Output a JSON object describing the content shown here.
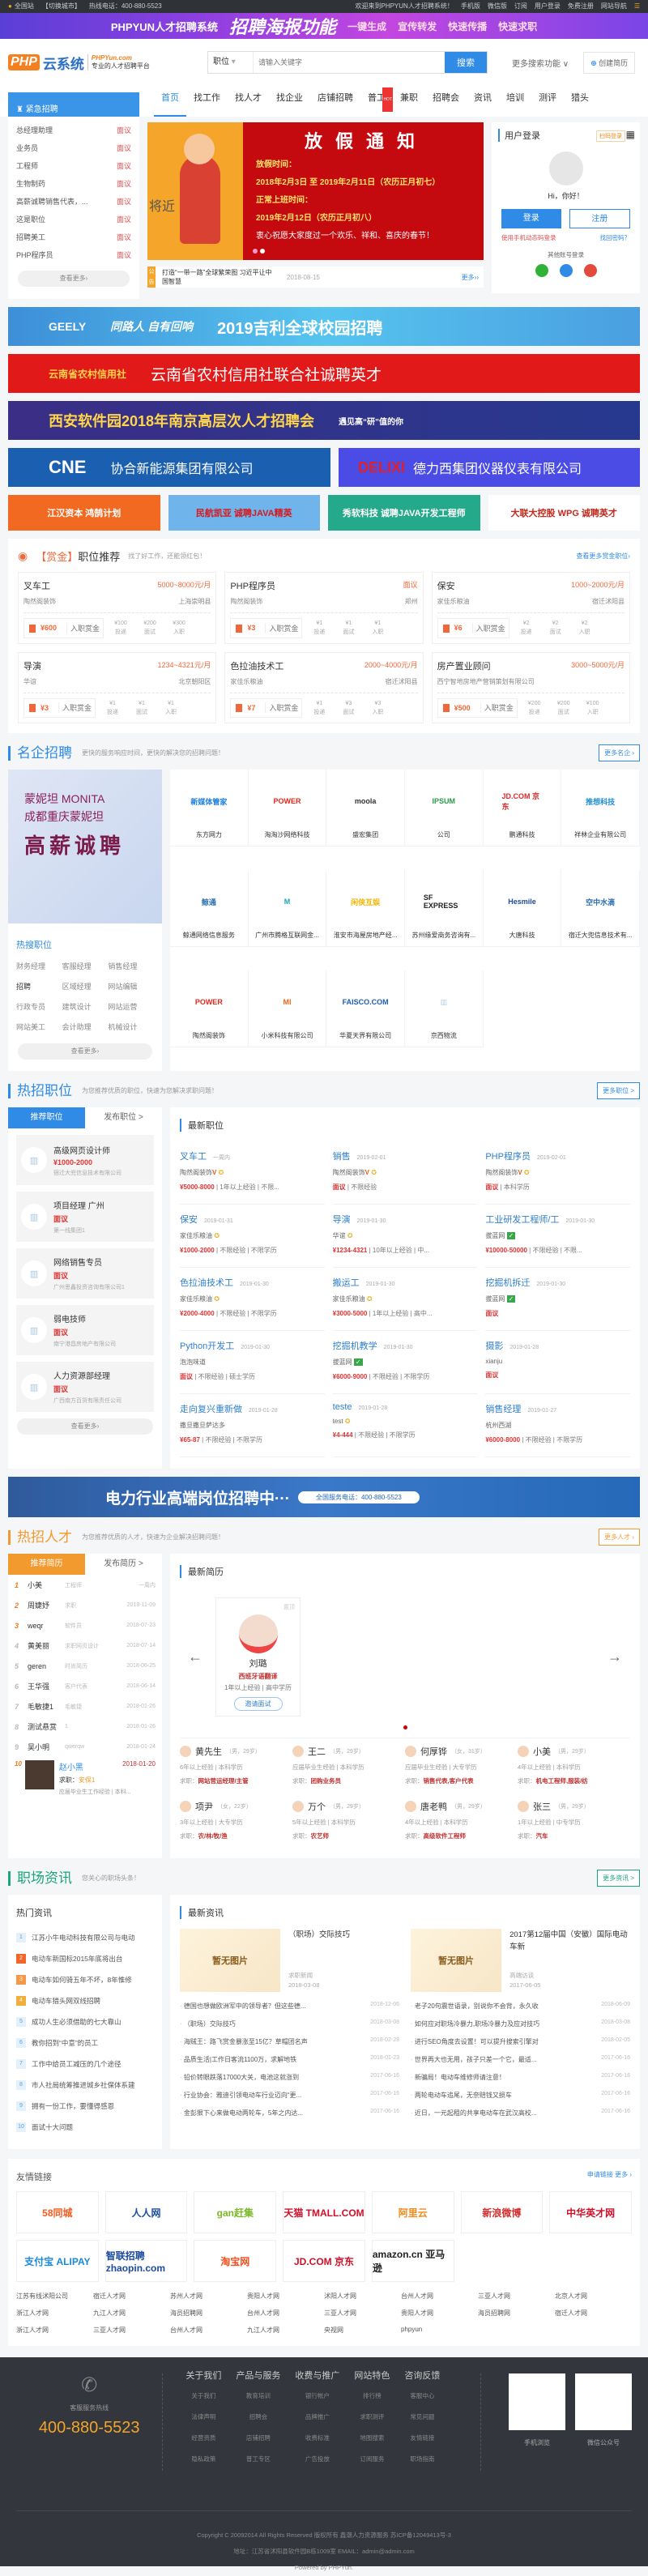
{
  "topbar": {
    "city": "全国站",
    "switch": "【切换城市】",
    "hotline": "热线电话：400-880-5523",
    "welcome": "欢迎来到PHPYUN人才招聘系统！",
    "mobile": "手机版",
    "wechat": "微信版",
    "subscribe": "订阅",
    "login": "用户登录",
    "register": "免费注册",
    "sitenav": "网站导航"
  },
  "promo": {
    "brand": "PHPYUN人才招聘系统",
    "headline": "招聘海报功能",
    "features": [
      "一键生成",
      "宣传转发",
      "快速传播",
      "快速求职"
    ]
  },
  "header": {
    "logo_php": "PHP",
    "logo_yun": "云系统",
    "logo_domain": "PHPYun.com",
    "logo_slogan": "专业的人才招聘平台",
    "search_type": "职位",
    "search_placeholder": "请输入关键字",
    "search_button": "搜索",
    "more_search": "更多搜索功能 ∨",
    "create_resume": "创建简历"
  },
  "nav": {
    "urgent_title": "紧急招聘",
    "items": [
      "首页",
      "找工作",
      "找人才",
      "找企业",
      "店铺招聘",
      "普工",
      "兼职",
      "招聘会",
      "资讯",
      "培训",
      "测评",
      "猎头"
    ],
    "hot_badge": "HOT"
  },
  "urgent": {
    "items": [
      {
        "name": "总经理助理",
        "salary": "面议"
      },
      {
        "name": "业务员",
        "salary": "面议"
      },
      {
        "name": "工程师",
        "salary": "面议"
      },
      {
        "name": "生物制药",
        "salary": "面议"
      },
      {
        "name": "高薪诚聘销售代表，...",
        "salary": "面议"
      },
      {
        "name": "这是职位",
        "salary": "面议"
      },
      {
        "name": "招聘美工",
        "salary": "面议"
      },
      {
        "name": "PHP程序员",
        "salary": "面议"
      }
    ],
    "more": "查看更多›"
  },
  "slider": {
    "title": "放假通知",
    "line1": "放假时间：",
    "line2": "2018年2月3日 至 2019年2月11日（农历正月初七）",
    "line3": "正常上班时间：",
    "line4": "2019年2月12日（农历正月初八）",
    "line5": "衷心祝愿大家度过一个欢乐、祥和、喜庆的春节！",
    "left_text": "将近"
  },
  "notice": {
    "tag": "公告",
    "text": "打造“一带一路”全球繁荣图 习近平让中国智慧",
    "date": "2018-08-15",
    "more": "更多››"
  },
  "login": {
    "title": "用户登录",
    "scan": "扫码登录",
    "hi": "Hi，你好！",
    "login": "登录",
    "register": "注册",
    "sms": "使用手机动态码登录",
    "forgot": "找回密码？",
    "other": "其他账号登录",
    "colors": {
      "wechat": "#2fb236",
      "qq": "#2f8be6",
      "weibo": "#e24b3b"
    }
  },
  "banners": {
    "geely": "2019吉利全球校园招聘",
    "geely_brand": "GEELY",
    "geely_slogan": "同路人 自有回响",
    "yn": "云南省农村信用社联合社诚聘英才",
    "yn_brand": "云南省农村信用社",
    "xa": "西安软件园2018年南京高层次人才招聘会",
    "xa_tag": "遇见高“研”值的你",
    "cne": "协合新能源集团有限公司",
    "cne_brand": "CNE",
    "delixi": "德力西集团仪器仪表有限公司",
    "delixi_brand": "DELIXI",
    "small": [
      "江汉资本 鸿鹄计划",
      "民航凯亚 诚聘JAVA精英",
      "秀软科技 诚聘JAVA开发工程师",
      "大联大控股 WPG 诚聘英才"
    ]
  },
  "reward": {
    "tag": "【赏金】",
    "title": "职位推荐",
    "sub": "找了好工作，还能领红包！",
    "more": "查看更多赏金职位›",
    "label": "入职赏金",
    "stages": [
      "投递",
      "面试",
      "入职"
    ],
    "cards": [
      {
        "name": "叉车工",
        "salary": "5000~8000元/月",
        "company": "陶然阁装饰",
        "loc": "上海崇明县",
        "money": "¥600",
        "s": [
          "¥100",
          "¥200",
          "¥300"
        ]
      },
      {
        "name": "PHP程序员",
        "salary": "面议",
        "company": "陶然阁装饰",
        "loc": "郑州",
        "money": "¥3",
        "s": [
          "¥1",
          "¥1",
          "¥1"
        ]
      },
      {
        "name": "保安",
        "salary": "1000~2000元/月",
        "company": "家佳乐粮油",
        "loc": "宿迁沭阳县",
        "money": "¥6",
        "s": [
          "¥2",
          "¥2",
          "¥2"
        ]
      },
      {
        "name": "导演",
        "salary": "1234~4321元/月",
        "company": "华谊",
        "loc": "北京朝阳区",
        "money": "¥3",
        "s": [
          "¥1",
          "¥1",
          "¥1"
        ]
      },
      {
        "name": "色拉油技术工",
        "salary": "2000~4000元/月",
        "company": "家佳乐粮油",
        "loc": "宿迁沭阳县",
        "money": "¥7",
        "s": [
          "¥1",
          "¥3",
          "¥3"
        ]
      },
      {
        "name": "房产置业顾问",
        "salary": "3000~5000元/月",
        "company": "西宁智地房地产营销策划有限公司",
        "loc": "",
        "money": "¥500",
        "s": [
          "¥200",
          "¥200",
          "¥100"
        ]
      }
    ]
  },
  "famous": {
    "title": "名企招聘",
    "sub": "更快的服务响应时间，更快的解决您的招聘问题！",
    "more": "更多名企 ›",
    "ad_brand": "蒙妮坦 MONITA",
    "ad_line": "成都重庆蒙妮坦",
    "ad_big": "高薪诚聘",
    "hot_title": "热搜职位",
    "hot": [
      "财务经理",
      "客服经理",
      "销售经理",
      "招聘",
      "区域经理",
      "网站编辑",
      "行政专员",
      "建筑设计",
      "网站运营",
      "网站美工",
      "会计助理",
      "机械设计"
    ],
    "more_btn": "查看更多›",
    "companies": [
      {
        "name": "东方网力",
        "logo": "新媒体管家",
        "color": "#1b7fe0"
      },
      {
        "name": "淘淘沙网络科技",
        "logo": "POWER",
        "color": "#e0281e"
      },
      {
        "name": "盛宏集团",
        "logo": "moola",
        "color": "#333333"
      },
      {
        "name": "公司",
        "logo": "IPSUM",
        "color": "#2a9a4a"
      },
      {
        "name": "鹏通科技",
        "logo": "JD.COM 京东",
        "color": "#d92b2b"
      },
      {
        "name": "祥林企业有限公司",
        "logo": "推想科技",
        "color": "#1f8fd0"
      },
      {
        "name": "鲸通网络信息服务",
        "logo": "鲸通",
        "color": "#2a6fb0"
      },
      {
        "name": "广州市腾格互联网金...",
        "logo": "M",
        "color": "#1aa5b8"
      },
      {
        "name": "淮安市海屋房地产经...",
        "logo": "闲侠互娱",
        "color": "#f5b400"
      },
      {
        "name": "苏州缘爱商务咨询有...",
        "logo": "SF EXPRESS",
        "color": "#222222"
      },
      {
        "name": "大唐科技",
        "logo": "Hesmile",
        "color": "#1c4aa0"
      },
      {
        "name": "宿迁大兜信息技术有...",
        "logo": "空中水滴",
        "color": "#2a6fb0"
      },
      {
        "name": "陶然阁装饰",
        "logo": "POWER",
        "color": "#e0281e"
      },
      {
        "name": "小米科技有限公司",
        "logo": "MI",
        "color": "#e86a1a"
      },
      {
        "name": "华夏天界有限公司",
        "logo": "FAISCO.COM",
        "color": "#1f5fb0"
      },
      {
        "name": "京西物流",
        "logo": "▥",
        "color": "#b8cfe0"
      }
    ]
  },
  "hotjobs": {
    "title": "热招职位",
    "sub": "为您推荐优质的职位，快速为您解决求职问题！",
    "more": "更多职位 >",
    "tab1": "推荐职位",
    "tab2": "发布职位 >",
    "latest": "最新职位",
    "more_btn": "查看更多›",
    "recommended": [
      {
        "name": "高级网页设计师",
        "salary": "¥1000-2000",
        "company": "宿迁大兜信息技术有限公司"
      },
      {
        "name": "项目经理 广州",
        "salary": "面议",
        "company": "第一线集团1"
      },
      {
        "name": "网络销售专员",
        "salary": "面议",
        "company": "广州思鑫投资咨询有限公司1"
      },
      {
        "name": "弱电技师",
        "salary": "面议",
        "company": "南宁港昌房地产有限公司"
      },
      {
        "name": "人力资源部经理",
        "salary": "面议",
        "company": "广西南方百货有限责任公司"
      }
    ],
    "jobs": [
      {
        "name": "叉车工",
        "date": "一周内",
        "company": "陶然阁装饰",
        "badge": "V",
        "salary": "¥5000-8000",
        "meta": [
          "1年以上经验",
          "不限..."
        ]
      },
      {
        "name": "销售",
        "date": "2019-02-01",
        "company": "陶然阁装饰",
        "badge": "V",
        "salary": "面议",
        "meta": [
          "不限经验"
        ]
      },
      {
        "name": "PHP程序员",
        "date": "2019-02-01",
        "company": "陶然阁装饰",
        "badge": "V",
        "salary": "面议",
        "meta": [
          "本科学历"
        ]
      },
      {
        "name": "保安",
        "date": "2019-01-31",
        "company": "家佳乐粮油",
        "badge": "M",
        "salary": "¥1000-2000",
        "meta": [
          "不限经验",
          "不限学历"
        ]
      },
      {
        "name": "导演",
        "date": "2019-01-30",
        "company": "华谊",
        "badge": "M",
        "salary": "¥1234-4321",
        "meta": [
          "10年以上经验",
          "中..."
        ]
      },
      {
        "name": "工业研发工程师/工",
        "date": "2019-01-30",
        "company": "拔蓝网",
        "badge": "G",
        "salary": "¥10000-50000",
        "meta": [
          "不限经验",
          "不限..."
        ]
      },
      {
        "name": "色拉油技术工",
        "date": "2019-01-30",
        "company": "家佳乐粮油",
        "badge": "M",
        "salary": "¥2000-4000",
        "meta": [
          "不限经验",
          "不限学历"
        ]
      },
      {
        "name": "搬运工",
        "date": "2019-01-30",
        "company": "家佳乐粮油",
        "badge": "M",
        "salary": "¥3000-5000",
        "meta": [
          "1年以上经验",
          "高中..."
        ]
      },
      {
        "name": "挖掘机拆迁",
        "date": "2019-01-30",
        "company": "拔蓝网",
        "badge": "G",
        "salary": "面议",
        "meta": []
      },
      {
        "name": "Python开发工",
        "date": "2019-01-30",
        "company": "泡泡味道",
        "badge": "",
        "salary": "面议",
        "meta": [
          "不限经验",
          "硕士学历"
        ]
      },
      {
        "name": "挖掘机教学",
        "date": "2019-01-30",
        "company": "拔蓝网",
        "badge": "G",
        "salary": "¥6000-9000",
        "meta": [
          "不限经验",
          "不限学历"
        ]
      },
      {
        "name": "摄影",
        "date": "2019-01-28",
        "company": "xianju",
        "badge": "",
        "salary": "面议",
        "meta": []
      },
      {
        "name": "走向复兴重新做",
        "date": "2019-01-28",
        "company": "撒旦撒旦萨达多",
        "badge": "",
        "salary": "¥65-87",
        "meta": [
          "不限经验",
          "不限学历"
        ]
      },
      {
        "name": "teste",
        "date": "2019-01-28",
        "company": "test",
        "badge": "M",
        "salary": "¥4-444",
        "meta": [
          "不限经验",
          "不限学历"
        ]
      },
      {
        "name": "销售经理",
        "date": "2019-01-27",
        "company": "杭州西湖",
        "badge": "",
        "salary": "¥6000-8000",
        "meta": [
          "不限经验",
          "不限学历"
        ]
      }
    ]
  },
  "power_banner": {
    "title": "电力行业高端岗位招聘中···",
    "phone": "全国服务电话：400-880-5523"
  },
  "talent": {
    "title": "热招人才",
    "sub": "为您推荐优质的人才，快速为企业解决招聘问题！",
    "more": "更多人才 ›",
    "tab1": "推荐简历",
    "tab2": "发布简历 >",
    "latest": "最新简历",
    "ranking": [
      {
        "no": "1",
        "name": "小美",
        "job": "工程师",
        "date": "一周内"
      },
      {
        "no": "2",
        "name": "周婕妤",
        "job": "求职",
        "date": "2018-11-09"
      },
      {
        "no": "3",
        "name": "weqr",
        "job": "软件员",
        "date": "2018-07-23"
      },
      {
        "no": "4",
        "name": "黄美丽",
        "job": "求职网页设计",
        "date": "2018-07-14"
      },
      {
        "no": "5",
        "name": "geren",
        "job": "时尚简历",
        "date": "2018-06-25"
      },
      {
        "no": "6",
        "name": "王华强",
        "job": "客户代表",
        "date": "2018-06-14"
      },
      {
        "no": "7",
        "name": "毛敏捷1",
        "job": "毛敏捷",
        "date": "2018-01-26"
      },
      {
        "no": "8",
        "name": "测试悬赏",
        "job": "1",
        "date": "2018-01-26"
      },
      {
        "no": "9",
        "name": "吴小明",
        "job": "qwerqw",
        "date": "2018-01-24"
      }
    ],
    "featured": {
      "no": "10",
      "name": "赵小黑",
      "date": "2018-01-20",
      "job_label": "求职：",
      "job": "安保1",
      "meta": "应届毕业生工作经验 | 本科..."
    },
    "card": {
      "tag": "置顶",
      "name": "刘璐",
      "position": "西班牙语翻译",
      "meta": "1年以上经验 | 高中学历",
      "invite": "邀请面试"
    },
    "resumes": [
      {
        "name": "黄先生",
        "info": "（男，29岁）",
        "meta": "6年以上经验 | 本科学历",
        "job": "网站营运经理/主管"
      },
      {
        "name": "王二",
        "info": "（男，29岁）",
        "meta": "应届毕业生经验 | 本科学历",
        "job": "团购业务员"
      },
      {
        "name": "何厚铧",
        "info": "（女，31岁）",
        "meta": "应届毕业生经验 | 大专学历",
        "job": "销售代表,客户代表"
      },
      {
        "name": "小美",
        "info": "（男，29岁）",
        "meta": "4年以上经验 | 本科学历",
        "job": "机电工程师,服装/纺"
      },
      {
        "name": "项尹",
        "info": "（女，22岁）",
        "meta": "3年以上经验 | 大专学历",
        "job": "农/林/牧/渔"
      },
      {
        "name": "万个",
        "info": "（男，29岁）",
        "meta": "5年以上经验 | 本科学历",
        "job": "农艺师"
      },
      {
        "name": "唐老鸭",
        "info": "（男，29岁）",
        "meta": "4年以上经验 | 本科学历",
        "job": "高级软件工程师"
      },
      {
        "name": "张三",
        "info": "（男，29岁）",
        "meta": "1年以上经验 | 中专学历",
        "job": "汽车"
      }
    ],
    "job_label": "求职："
  },
  "news": {
    "title": "职场资讯",
    "sub": "您关心的职场头条！",
    "more": "更多资讯 >",
    "hot_title": "热门资讯",
    "latest": "最新资讯",
    "hot": [
      "江苏小牛电动科技有限公司与电动",
      "电动车新国标2015年底将出台",
      "电动车如何骑五年不坏，8年惟修",
      "电动车猎头网双线招聘",
      "成功人生必须借助的七大靠山",
      "教你招到“中意”的员工",
      "工作中给员工减压的几个途径",
      "市人社局统筹推进城乡社保体系建",
      "拥有一份工作，要懂得感恩",
      "面试十大问题"
    ],
    "no_image": "暂无图片",
    "featured": [
      {
        "title": "（职场）交际技巧",
        "cat": "求职新闻",
        "date": "2018-03-08"
      },
      {
        "title": "2017第12届中国（安徽）国际电动车新",
        "cat": "高端访谈",
        "date": "2017-06-05"
      }
    ],
    "list": [
      {
        "t": "德国也想做欧洲军中的领导者？但这些德...",
        "d": "2018-12-06"
      },
      {
        "t": "老子20句震世语录，别说你不会背，永久收",
        "d": "2018-06-09"
      },
      {
        "t": "（职场）交际技巧",
        "d": "2018-03-08"
      },
      {
        "t": "如何应对职场冷暴力,职场冷暴力及应对技巧",
        "d": "2018-03-08"
      },
      {
        "t": "海贼王：路飞赏金暴涨至15亿？草帽团名声",
        "d": "2018-02-28"
      },
      {
        "t": "进行SEO角度去设置！可以提升搜索引擎对",
        "d": "2018-02-05"
      },
      {
        "t": "品质生活|工作日客流1100万，求解地铁",
        "d": "2018-01-23"
      },
      {
        "t": "世界再大也无用，孩子只差一个它，最适...",
        "d": "2017-06-16"
      },
      {
        "t": "铅价转眼跌落17000大关，电池这就涨到",
        "d": "2017-06-16"
      },
      {
        "t": "新骗局！电动车维修师请注意！",
        "d": "2017-06-16"
      },
      {
        "t": "行业协会：雅迪引领电动车行业迈向“更...",
        "d": "2017-06-16"
      },
      {
        "t": "两轮电动车追尾，无奈赔钱又损车",
        "d": "2017-06-16"
      },
      {
        "t": "金彭狠下心来做电动两轮车，5年之内达...",
        "d": "2017-06-16"
      },
      {
        "t": "近日，一元起租的共享电动车在武汉高校...",
        "d": "2017-06-16"
      }
    ]
  },
  "links": {
    "title": "友情链接",
    "more": "申请链接 更多 ›",
    "logos": [
      {
        "n": "58同城",
        "c": "#f55a1e"
      },
      {
        "n": "人人网",
        "c": "#1c4fa0"
      },
      {
        "n": "gan赶集",
        "c": "#7ab828"
      },
      {
        "n": "天猫 TMALL.COM",
        "c": "#d0102a"
      },
      {
        "n": "阿里云",
        "c": "#f08a1a"
      },
      {
        "n": "新浪微博",
        "c": "#d52b2b"
      },
      {
        "n": "中华英才网",
        "c": "#d0102a"
      },
      {
        "n": "支付宝 ALIPAY",
        "c": "#1a8ad8"
      },
      {
        "n": "智联招聘 zhaopin.com",
        "c": "#1b4aa0"
      },
      {
        "n": "淘宝网",
        "c": "#f0501e"
      },
      {
        "n": "JD.COM 京东",
        "c": "#d0102a"
      },
      {
        "n": "amazon.cn 亚马逊",
        "c": "#222222"
      }
    ],
    "text": [
      "江苏有线沭阳公司",
      "宿迁人才网",
      "苏州人才网",
      "贵阳人才网",
      "沭阳人才网",
      "台州人才网",
      "三亚人才网",
      "北京人才网",
      "浙江人才网",
      "九江人才网",
      "海员招聘网",
      "台州人才网",
      "三亚人才网",
      "贵阳人才网",
      "海员招聘网",
      "宿迁人才网",
      "浙江人才网",
      "三亚人才网",
      "台州人才网",
      "九江人才网",
      "央视网",
      "phpyun"
    ]
  },
  "footer": {
    "hotline_label": "客服服务热线",
    "hotline": "400-880-5523",
    "cols": [
      {
        "h": "关于我们",
        "items": [
          "关于我们",
          "法律声明",
          "经营资质",
          "隐私政策"
        ]
      },
      {
        "h": "产品与服务",
        "items": [
          "教育培训",
          "招聘会",
          "店铺招聘",
          "普工专区"
        ]
      },
      {
        "h": "收费与推广",
        "items": [
          "银行帐户",
          "品牌推广",
          "收费标准",
          "广告投放"
        ]
      },
      {
        "h": "网站特色",
        "items": [
          "排行榜",
          "求职测评",
          "地图搜索",
          "订阅服务"
        ]
      },
      {
        "h": "咨询反馈",
        "items": [
          "客服中心",
          "常见问题",
          "友情链接",
          "职场指南"
        ]
      }
    ],
    "qr1": "手机浏览",
    "qr2": "微信公众号",
    "copyright": "Copyright C 20092014 All Rights Reserved 版权所有 鑫潮人力资源服务 苏ICP备12049413号-3",
    "address": "地址：江苏省沭阳县软件园B栋1009室 EMAIL：admin@admin.com",
    "powered": "Powered by PHPYun."
  }
}
